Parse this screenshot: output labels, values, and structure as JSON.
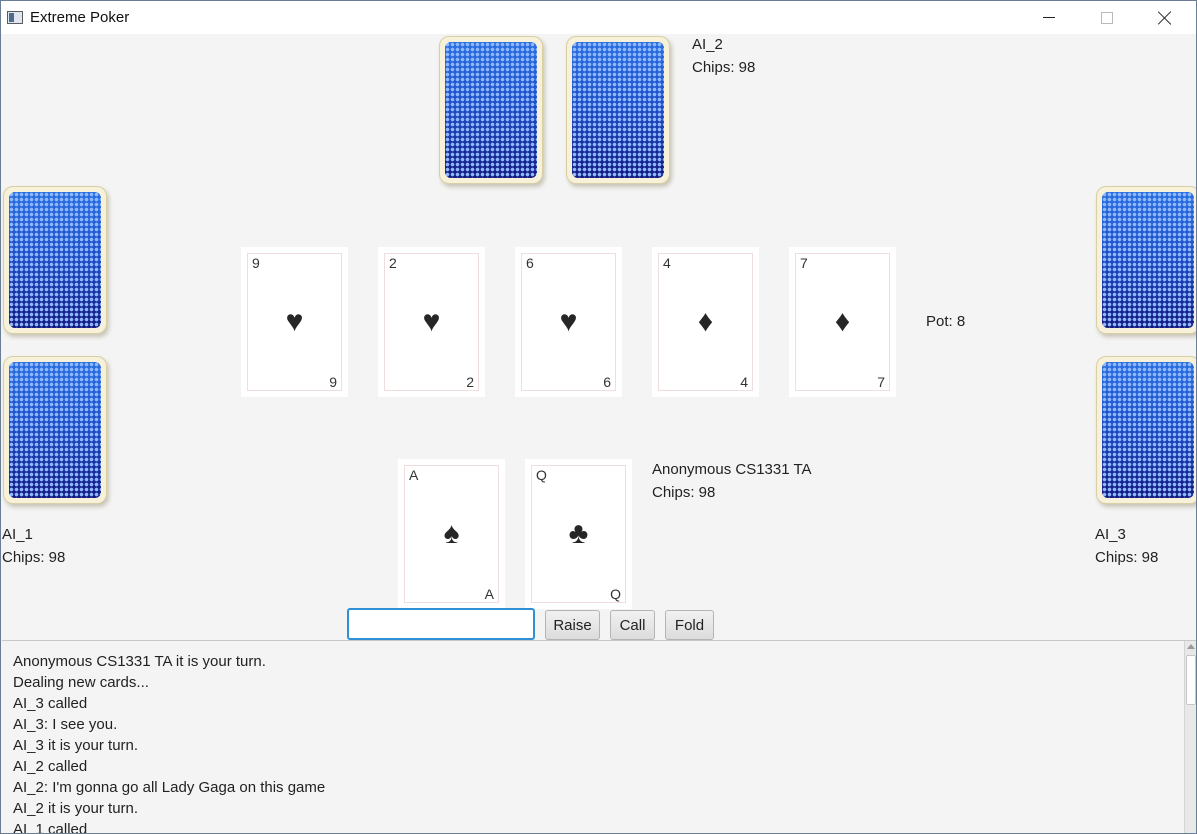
{
  "window": {
    "title": "Extreme Poker",
    "controls": [
      "minimize",
      "maximize",
      "close"
    ]
  },
  "players": {
    "ai_2": {
      "name": "AI_2",
      "chips": "Chips: 98"
    },
    "ai_1": {
      "name": "AI_1",
      "chips": "Chips: 98"
    },
    "ai_3": {
      "name": "AI_3",
      "chips": "Chips: 98"
    },
    "human": {
      "name": "Anonymous CS1331 TA",
      "chips": "Chips: 98"
    }
  },
  "community_cards": [
    {
      "rank": "9",
      "suit": "♥"
    },
    {
      "rank": "2",
      "suit": "♥"
    },
    {
      "rank": "6",
      "suit": "♥"
    },
    {
      "rank": "4",
      "suit": "♦"
    },
    {
      "rank": "7",
      "suit": "♦"
    }
  ],
  "hand_cards": [
    {
      "rank": "A",
      "suit": "♠"
    },
    {
      "rank": "Q",
      "suit": "♣"
    }
  ],
  "pot": "Pot: 8",
  "controls": {
    "bet_value": "",
    "raise_label": "Raise",
    "call_label": "Call",
    "fold_label": "Fold"
  },
  "log": [
    "Anonymous CS1331 TA it is your turn.",
    "Dealing new cards...",
    "AI_3 called",
    "AI_3: I see you.",
    "AI_3 it is your turn.",
    "AI_2 called",
    "AI_2: I'm gonna go all Lady Gaga on this game",
    "AI_2 it is your turn.",
    "AI_1 called"
  ]
}
